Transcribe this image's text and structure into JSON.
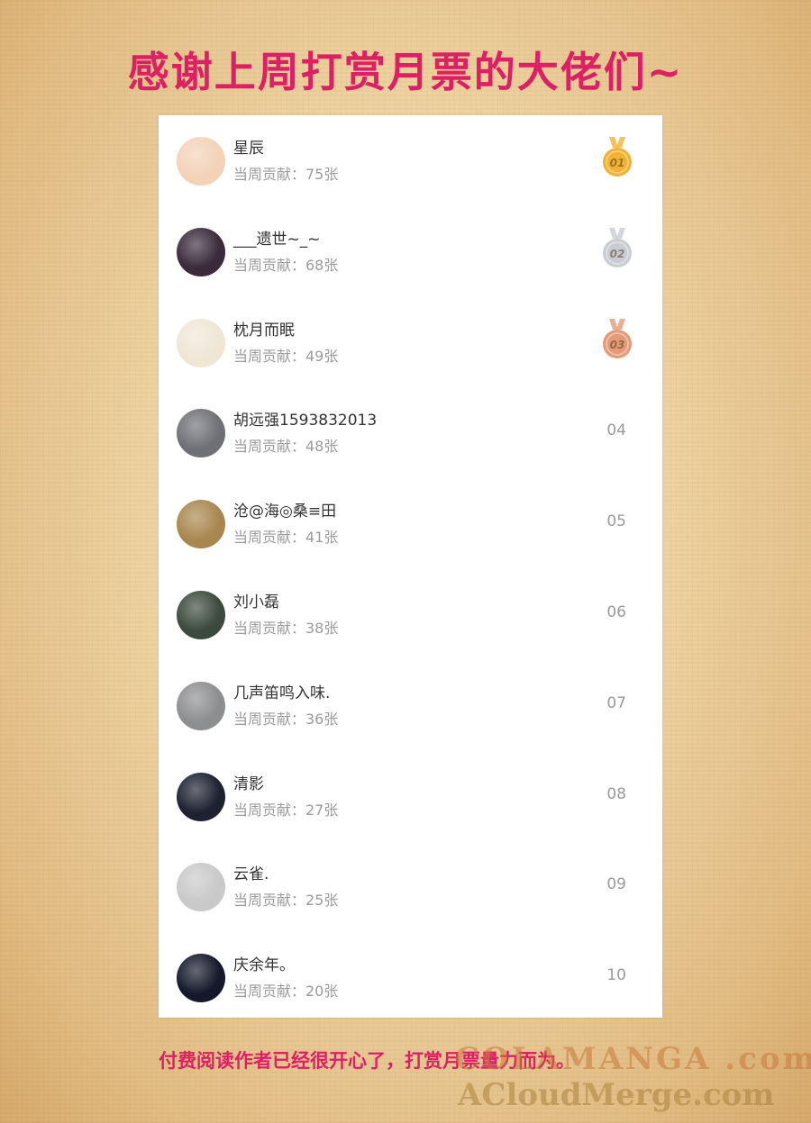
{
  "header": {
    "title": "感谢上周打赏月票的大佬们~"
  },
  "ranking": [
    {
      "name": "星辰",
      "contribution": "当周贡献：75张",
      "rank": "01",
      "medal": "gold",
      "avatar_color": "#f3d2b8"
    },
    {
      "name": "___遗世~_~",
      "contribution": "当周贡献：68张",
      "rank": "02",
      "medal": "silver",
      "avatar_color": "#3a2a3a"
    },
    {
      "name": "枕月而眠",
      "contribution": "当周贡献：49张",
      "rank": "03",
      "medal": "bronze",
      "avatar_color": "#efe6d6"
    },
    {
      "name": "胡远强1593832013",
      "contribution": "当周贡献：48张",
      "rank": "04",
      "avatar_color": "#6f7075"
    },
    {
      "name": "沧@海◎桑≡田",
      "contribution": "当周贡献：41张",
      "rank": "05",
      "avatar_color": "#a8874f"
    },
    {
      "name": "刘小磊",
      "contribution": "当周贡献：38张",
      "rank": "06",
      "avatar_color": "#3b4a3c"
    },
    {
      "name": "几声笛鸣入味.",
      "contribution": "当周贡献：36张",
      "rank": "07",
      "avatar_color": "#8d8e90"
    },
    {
      "name": "清影",
      "contribution": "当周贡献：27张",
      "rank": "08",
      "avatar_color": "#1d2130"
    },
    {
      "name": "云雀.",
      "contribution": "当周贡献：25张",
      "rank": "09",
      "avatar_color": "#c9c9c9"
    },
    {
      "name": "庆余年。",
      "contribution": "当周贡献：20张",
      "rank": "10",
      "avatar_color": "#15182a"
    }
  ],
  "footer": {
    "text": "付费阅读作者已经很开心了，打赏月票量力而为。"
  },
  "watermark": {
    "line1": "COLAMANGA .com",
    "line2": "ACloudMerge.com"
  },
  "colors": {
    "accent": "#dd1f64",
    "gold": "#f2b233",
    "silver": "#c9ccd3",
    "bronze": "#e39b78"
  }
}
